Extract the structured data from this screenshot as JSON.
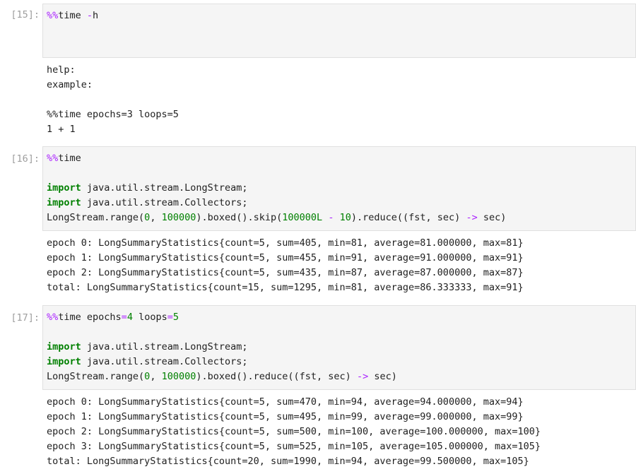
{
  "cells": [
    {
      "prompt": "[15]:",
      "input": [
        [
          {
            "t": "%%",
            "c": "magic"
          },
          {
            "t": "time ",
            "c": "plain"
          },
          {
            "t": "-",
            "c": "op"
          },
          {
            "t": "h",
            "c": "plain"
          }
        ]
      ],
      "output": [
        "help:",
        "example:",
        "",
        "%%time epochs=3 loops=5",
        "1 + 1"
      ]
    },
    {
      "prompt": "[16]:",
      "input": [
        [
          {
            "t": "%%",
            "c": "magic"
          },
          {
            "t": "time",
            "c": "plain"
          }
        ],
        [],
        [
          {
            "t": "import",
            "c": "kw"
          },
          {
            "t": " java.util.stream.LongStream;",
            "c": "plain"
          }
        ],
        [
          {
            "t": "import",
            "c": "kw"
          },
          {
            "t": " java.util.stream.Collectors;",
            "c": "plain"
          }
        ],
        [
          {
            "t": "LongStream.range(",
            "c": "plain"
          },
          {
            "t": "0",
            "c": "num"
          },
          {
            "t": ", ",
            "c": "plain"
          },
          {
            "t": "100000",
            "c": "num"
          },
          {
            "t": ").boxed().skip(",
            "c": "plain"
          },
          {
            "t": "100000L",
            "c": "num"
          },
          {
            "t": " ",
            "c": "plain"
          },
          {
            "t": "-",
            "c": "op"
          },
          {
            "t": " ",
            "c": "plain"
          },
          {
            "t": "10",
            "c": "num"
          },
          {
            "t": ").reduce((fst, sec) ",
            "c": "plain"
          },
          {
            "t": "->",
            "c": "op"
          },
          {
            "t": " sec)",
            "c": "plain"
          }
        ]
      ],
      "output": [
        "epoch 0: LongSummaryStatistics{count=5, sum=405, min=81, average=81.000000, max=81}",
        "epoch 1: LongSummaryStatistics{count=5, sum=455, min=91, average=91.000000, max=91}",
        "epoch 2: LongSummaryStatistics{count=5, sum=435, min=87, average=87.000000, max=87}",
        "total: LongSummaryStatistics{count=15, sum=1295, min=81, average=86.333333, max=91}"
      ]
    },
    {
      "prompt": "[17]:",
      "input": [
        [
          {
            "t": "%%",
            "c": "magic"
          },
          {
            "t": "time epochs",
            "c": "plain"
          },
          {
            "t": "=",
            "c": "op"
          },
          {
            "t": "4",
            "c": "num"
          },
          {
            "t": " loops",
            "c": "plain"
          },
          {
            "t": "=",
            "c": "op"
          },
          {
            "t": "5",
            "c": "num"
          }
        ],
        [],
        [
          {
            "t": "import",
            "c": "kw"
          },
          {
            "t": " java.util.stream.LongStream;",
            "c": "plain"
          }
        ],
        [
          {
            "t": "import",
            "c": "kw"
          },
          {
            "t": " java.util.stream.Collectors;",
            "c": "plain"
          }
        ],
        [
          {
            "t": "LongStream.range(",
            "c": "plain"
          },
          {
            "t": "0",
            "c": "num"
          },
          {
            "t": ", ",
            "c": "plain"
          },
          {
            "t": "100000",
            "c": "num"
          },
          {
            "t": ").boxed().reduce((fst, sec) ",
            "c": "plain"
          },
          {
            "t": "->",
            "c": "op"
          },
          {
            "t": " sec)",
            "c": "plain"
          }
        ]
      ],
      "output": [
        "epoch 0: LongSummaryStatistics{count=5, sum=470, min=94, average=94.000000, max=94}",
        "epoch 1: LongSummaryStatistics{count=5, sum=495, min=99, average=99.000000, max=99}",
        "epoch 2: LongSummaryStatistics{count=5, sum=500, min=100, average=100.000000, max=100}",
        "epoch 3: LongSummaryStatistics{count=5, sum=525, min=105, average=105.000000, max=105}",
        "total: LongSummaryStatistics{count=20, sum=1990, min=94, average=99.500000, max=105}"
      ]
    }
  ]
}
